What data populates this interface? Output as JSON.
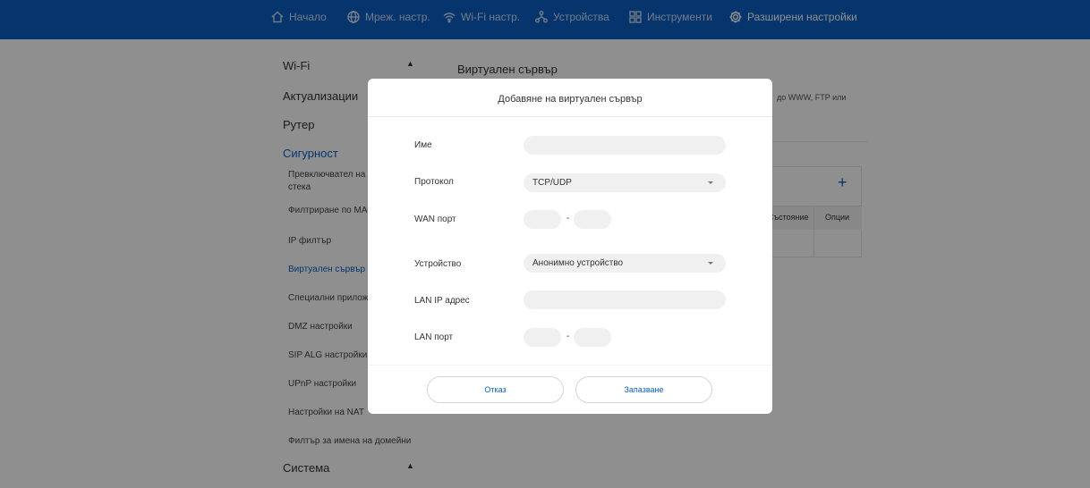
{
  "nav": {
    "items": [
      {
        "label": "Начало",
        "icon": "home-icon"
      },
      {
        "label": "Мреж. настр.",
        "icon": "globe-icon"
      },
      {
        "label": "Wi-Fi настр.",
        "icon": "wifi-icon"
      },
      {
        "label": "Устройства",
        "icon": "devices-icon"
      },
      {
        "label": "Инструменти",
        "icon": "tools-icon"
      },
      {
        "label": "Разширени настройки",
        "icon": "gear-icon"
      }
    ],
    "active_index": 5
  },
  "sidebar": {
    "sections": [
      {
        "label": "Wi-Fi"
      },
      {
        "label": "Актуализации"
      },
      {
        "label": "Рутер"
      },
      {
        "label": "Сигурност"
      },
      {
        "label": "Система"
      }
    ],
    "security_items": [
      {
        "label": "Превключвател на з"
      },
      {
        "label": "стека"
      },
      {
        "label": "Филтриране по МАС"
      },
      {
        "label": "IP филтър"
      },
      {
        "label": "Виртуален сървър"
      },
      {
        "label": "Специални прилож"
      },
      {
        "label": "DMZ настройки"
      },
      {
        "label": "SIP ALG настройки"
      },
      {
        "label": "UPnP настройки"
      },
      {
        "label": "Настройки на NAT"
      },
      {
        "label": "Филтър за имена на домейни"
      }
    ]
  },
  "content": {
    "title": "Виртуален сървър",
    "description_fragment": "до WWW, FTP или",
    "add_symbol": "+",
    "table_headers": [
      "Състояние",
      "Опции"
    ]
  },
  "modal": {
    "title": "Добавяне на виртуален сървър",
    "fields": {
      "name_label": "Име",
      "name_value": "",
      "protocol_label": "Протокол",
      "protocol_value": "TCP/UDP",
      "wan_port_label": "WAN порт",
      "wan_port_start": "",
      "wan_port_end": "",
      "device_label": "Устройство",
      "device_value": "Анонимно устройство",
      "lan_ip_label": "LAN IP адрес",
      "lan_ip_value": "",
      "lan_port_label": "LAN порт",
      "lan_port_start": "",
      "lan_port_end": "",
      "range_separator": "-"
    },
    "cancel_label": "Отказ",
    "save_label": "Запазване"
  },
  "colors": {
    "brand_blue": "#0b5fc4",
    "overlay": "rgba(0,0,0,0.44)"
  }
}
